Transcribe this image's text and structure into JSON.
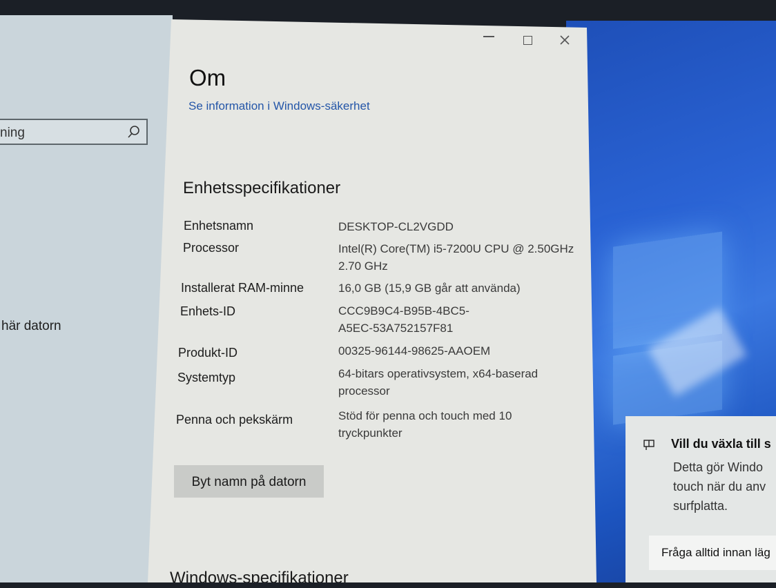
{
  "left_pane": {
    "search_text": "ning",
    "link_text": "här datorn"
  },
  "window": {
    "title": "Om",
    "security_link": "Se information i Windows-säkerhet",
    "device_section": "Enhetsspecifikationer",
    "specs": [
      {
        "label": "Enhetsnamn",
        "value": "DESKTOP-CL2VGDD"
      },
      {
        "label": "Processor",
        "value": "Intel(R) Core(TM) i5-7200U CPU @ 2.50GHz 2.70 GHz"
      },
      {
        "label": "Installerat RAM-minne",
        "value": "16,0 GB (15,9 GB går att använda)"
      },
      {
        "label": "Enhets-ID",
        "value": "CCC9B9C4-B95B-4BC5-A5EC-53A752157F81"
      },
      {
        "label": "Produkt-ID",
        "value": "00325-96144-98625-AAOEM"
      },
      {
        "label": "Systemtyp",
        "value": "64-bitars operativsystem, x64-baserad processor"
      },
      {
        "label": "Penna och pekskärm",
        "value": "Stöd för penna och touch med 10 tryckpunkter"
      }
    ],
    "rename_button": "Byt namn på datorn",
    "windows_section": "Windows-specifikationer"
  },
  "toast": {
    "title": "Vill du växla till s",
    "body": "Detta gör Windo touch när du anv surfplatta.",
    "button": "Fråga alltid innan läg"
  }
}
